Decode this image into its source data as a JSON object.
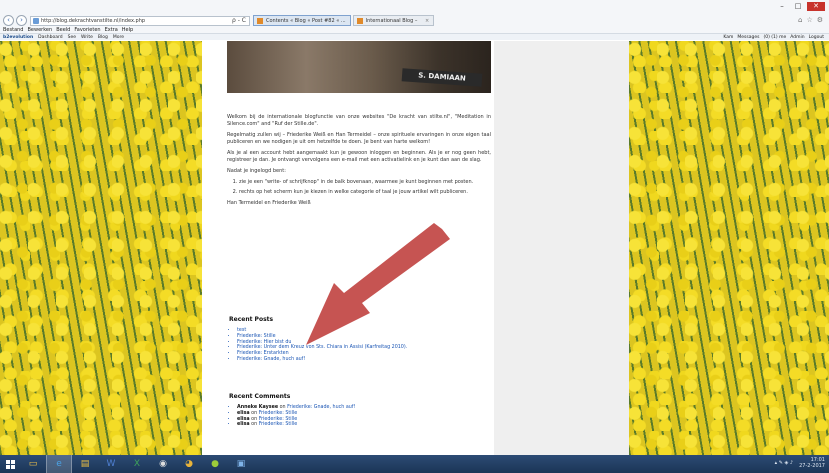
{
  "browser": {
    "address": "http://blog.dekrachtvanstilte.nl/index.php",
    "addr_tools": "ρ - C",
    "tabs": [
      {
        "label": "Contents « Blog « Post #82 « ..."
      },
      {
        "label": "Internationaal Blog –"
      }
    ],
    "tab_close": "×",
    "menu": [
      "Bestand",
      "Bewerken",
      "Beeld",
      "Favorieten",
      "Extra",
      "Help"
    ],
    "window": {
      "minimize": "–",
      "maximize": "□",
      "close": "✕"
    }
  },
  "wpbar": {
    "brand": "b2evolution",
    "items": [
      "Dashboard",
      "See",
      "Write",
      "Blog",
      "More"
    ],
    "right_items": [
      "Kam",
      "Messages",
      "(0) (1) me",
      "Admin",
      "Logout"
    ]
  },
  "header_image": {
    "sign_text": "S. DAMIAAN"
  },
  "intro": {
    "p1": "Welkom bij de internationale blogfunctie van onze websites \"De kracht van stilte.nl\", \"Meditation in Silence.com\" and \"Ruf der Stille.de\".",
    "p2": "Regelmatig zullen wij – Friederike Weiß en Han Termeidel – onze spirituele ervaringen in onze eigen taal publiceren en we nodigen je uit om hetzelfde te doen. Je bent van harte welkom!",
    "p3": "Als je al een account hebt aangemaakt kun je gewoon inloggen en beginnen. Als je er nog geen hebt, registreer je dan. Je ontvangt vervolgens een e-mail met een activatielink en je kunt dan aan de slag.",
    "p4": "Nadat je ingelogd bent:",
    "steps": [
      "zie je een \"write- of schrijfknop\" in de balk bovenaan, waarmee je kunt beginnen met posten.",
      "rechts op het scherm kun je kiezen in welke categorie of taal je jouw artikel wilt publiceren."
    ],
    "signature": "Han Termeidel en Friederike Weiß"
  },
  "recent_posts": {
    "title": "Recent Posts",
    "items": [
      "test",
      "Friederike: Stille",
      "Friederike: Hier bist du",
      "Friederike: Unter dem Kreuz von Sts. Chiara in Assisi (Karfreitag 2010).",
      "Friederike: Erstarkten",
      "Friederike: Gnade, huch auf!"
    ]
  },
  "recent_comments": {
    "title": "Recent Comments",
    "items": [
      {
        "author": "Anneke Kaysee",
        "on": "on",
        "post": "Friederike: Gnade, huch auf!"
      },
      {
        "author": "elisa",
        "on": "on",
        "post": "Friederike: Stille"
      },
      {
        "author": "elisa",
        "on": "on",
        "post": "Friederike: Stille"
      },
      {
        "author": "elisa",
        "on": "on",
        "post": "Friederike: Stille"
      }
    ]
  },
  "taskbar": {
    "icons": [
      "folder-icon",
      "internet-explorer-icon",
      "file-explorer-icon",
      "word-icon",
      "excel-icon",
      "media-icon",
      "chrome-icon",
      "app-icon",
      "photo-icon"
    ],
    "tray_icons": "▴ ✎ ◈ ♪",
    "clock_time": "17:01",
    "clock_date": "27-2-2017"
  },
  "colors": {
    "link": "#1a55b4",
    "taskbar": "#1b3556",
    "arrow": "#c0413f",
    "close": "#c7332c"
  }
}
